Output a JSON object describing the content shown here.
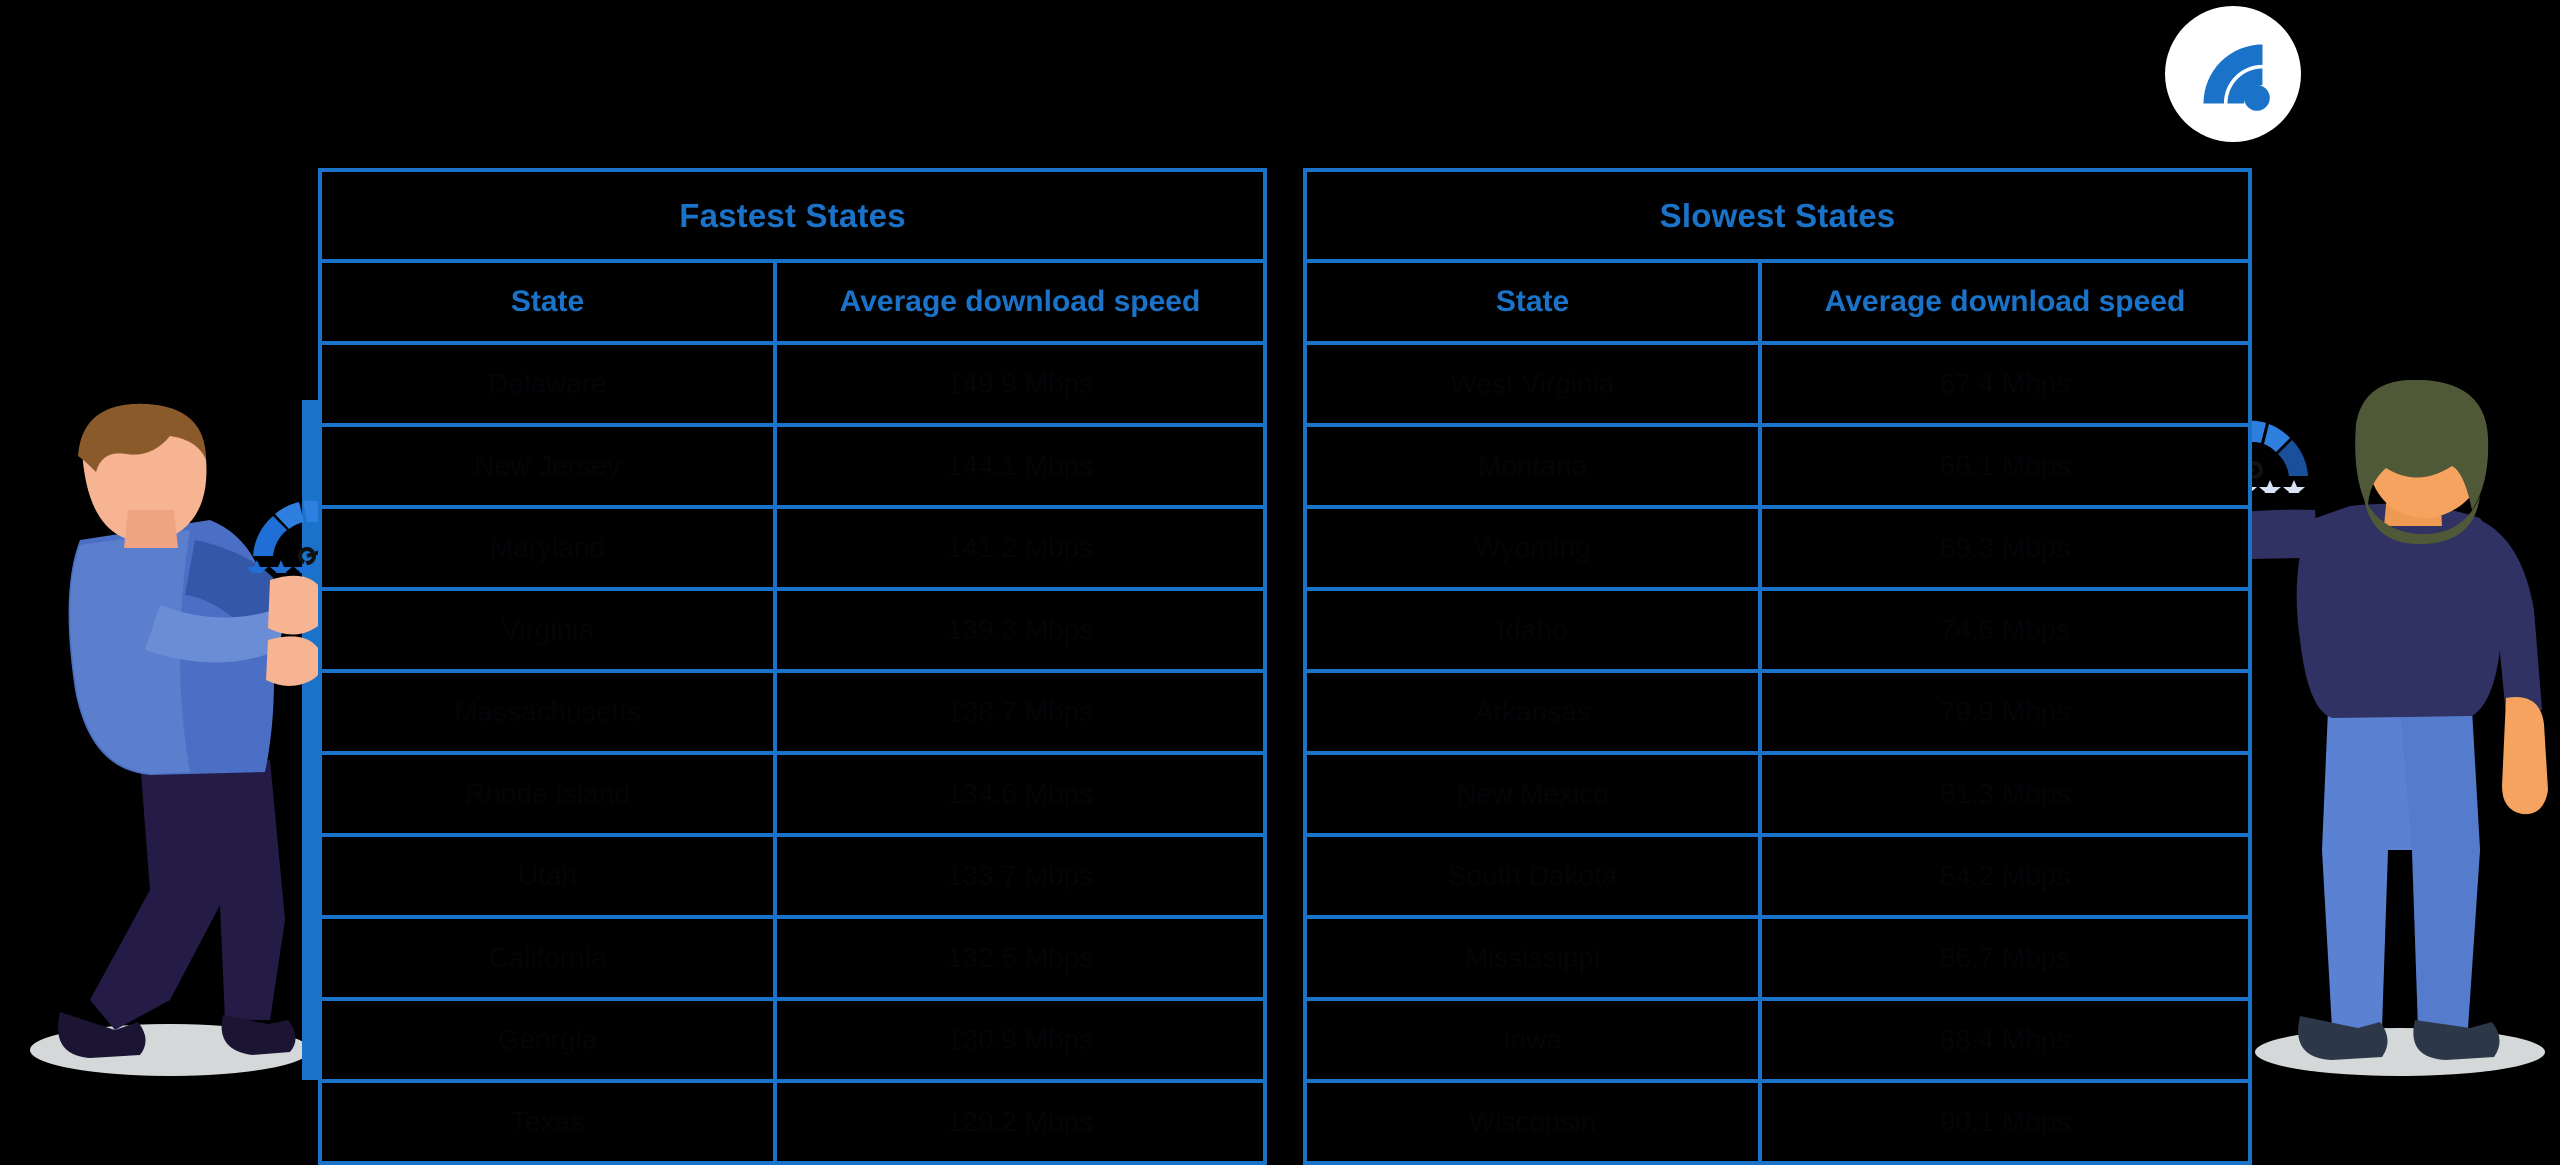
{
  "logo": {
    "name": "wifi-logo",
    "icon": "wifi-signal-icon",
    "background": "#ffffff",
    "color": "#1a73c9"
  },
  "colors": {
    "page_background": "#000000",
    "table_border": "#1a73c9",
    "heading_text": "#1a73c9",
    "cell_text": "#050509",
    "star_active": "#1f6fd6",
    "star_inactive": "#d7e3f4"
  },
  "tables": [
    {
      "id": "fastest-states",
      "title": "Fastest States",
      "columns": [
        "State",
        "Average download speed"
      ],
      "rows": [
        {
          "state": "Delaware",
          "speed": "149.9 Mbps"
        },
        {
          "state": "New Jersey",
          "speed": "144.1 Mbps"
        },
        {
          "state": "Maryland",
          "speed": "141.2 Mbps"
        },
        {
          "state": "Virginia",
          "speed": "139.3 Mbps"
        },
        {
          "state": "Massachusetts",
          "speed": "138.7 Mbps"
        },
        {
          "state": "Rhode Island",
          "speed": "134.6 Mbps"
        },
        {
          "state": "Utah",
          "speed": "133.7 Mbps"
        },
        {
          "state": "California",
          "speed": "132.5 Mbps"
        },
        {
          "state": "Georgia",
          "speed": "130.9 Mbps"
        },
        {
          "state": "Texas",
          "speed": "129.2 Mbps"
        }
      ]
    },
    {
      "id": "slowest-states",
      "title": "Slowest States",
      "columns": [
        "State",
        "Average download speed"
      ],
      "rows": [
        {
          "state": "West Virginia",
          "speed": "67.4 Mbps"
        },
        {
          "state": "Montana",
          "speed": "68.1 Mbps"
        },
        {
          "state": "Wyoming",
          "speed": "69.3 Mbps"
        },
        {
          "state": "Idaho",
          "speed": "74.6 Mbps"
        },
        {
          "state": "Arkansas",
          "speed": "79.9 Mbps"
        },
        {
          "state": "New Mexico",
          "speed": "81.3 Mbps"
        },
        {
          "state": "South Dakota",
          "speed": "84.2 Mbps"
        },
        {
          "state": "Mississippi",
          "speed": "86.7 Mbps"
        },
        {
          "state": "Iowa",
          "speed": "88.4 Mbps"
        },
        {
          "state": "Wisconsin",
          "speed": "90.1 Mbps"
        }
      ]
    }
  ],
  "illustrations": {
    "left": {
      "name": "man-thumbs-up-illustration",
      "gauge": {
        "name": "speed-gauge-high",
        "stars_total": 5,
        "stars_filled": 5
      },
      "gesture": "thumbs-up"
    },
    "right": {
      "name": "man-thumbs-down-illustration",
      "gauge": {
        "name": "speed-gauge-low",
        "stars_total": 5,
        "stars_filled": 1
      },
      "gesture": "thumbs-down"
    }
  }
}
